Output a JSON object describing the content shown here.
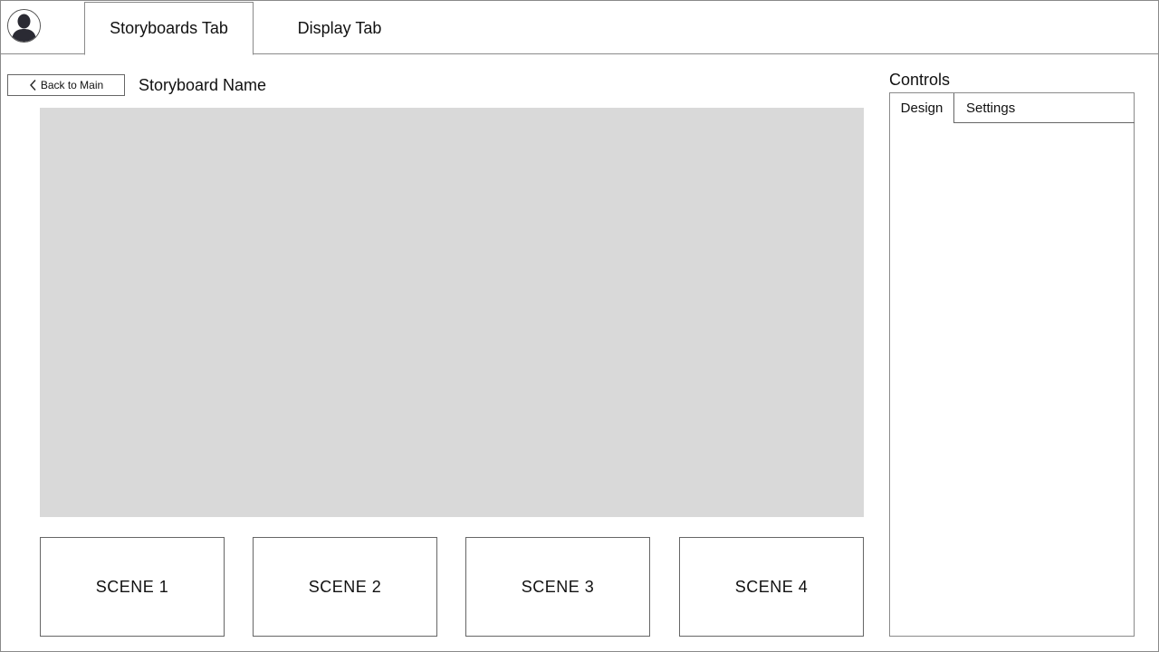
{
  "header": {
    "avatar_icon": "user-avatar-icon",
    "tabs": [
      {
        "label": "Storyboards Tab",
        "active": true
      },
      {
        "label": "Display Tab",
        "active": false
      }
    ]
  },
  "toolbar": {
    "back_label": "Back to Main",
    "back_icon": "chevron-left-icon",
    "storyboard_name": "Storyboard Name"
  },
  "scenes": [
    {
      "label": "SCENE 1"
    },
    {
      "label": "SCENE 2"
    },
    {
      "label": "SCENE 3"
    },
    {
      "label": "SCENE 4"
    }
  ],
  "controls": {
    "title": "Controls",
    "tabs": [
      {
        "label": "Design",
        "active": true
      },
      {
        "label": "Settings",
        "active": false
      }
    ]
  },
  "colors": {
    "canvas_fill": "#d9d9d9",
    "border": "#8a8a8a"
  }
}
